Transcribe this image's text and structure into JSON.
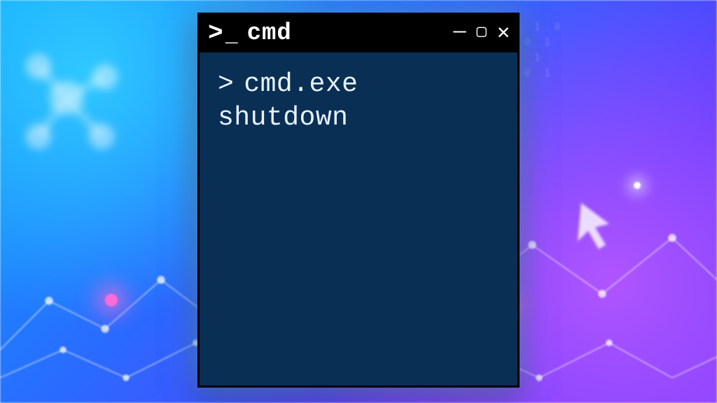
{
  "window": {
    "title": "cmd",
    "controls": {
      "minimize_glyph": "—",
      "maximize_glyph": "▢",
      "close_glyph": "✕"
    }
  },
  "terminal": {
    "prompt_symbol": ">",
    "command_line1": "cmd.exe",
    "command_line2": "shutdown"
  }
}
